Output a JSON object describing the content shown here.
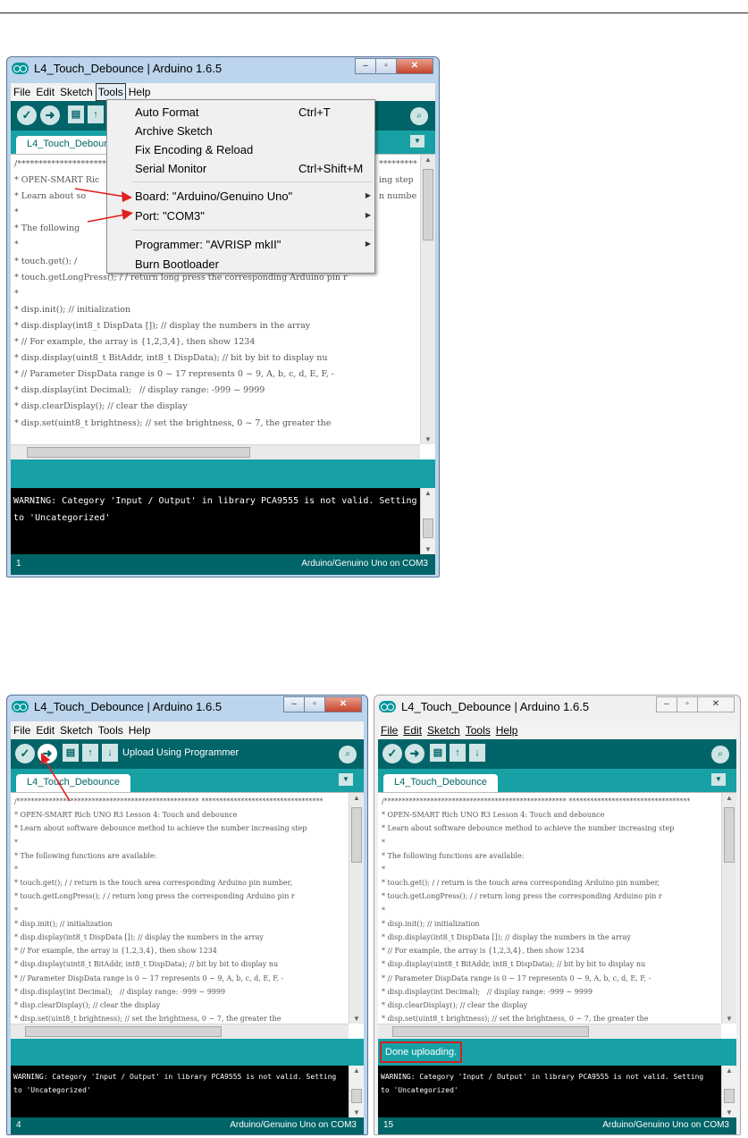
{
  "title": "L4_Touch_Debounce | Arduino 1.6.5",
  "tab_label": "L4_Touch_Debounce",
  "menus": [
    "File",
    "Edit",
    "Sketch",
    "Tools",
    "Help"
  ],
  "tools_menu": {
    "items": [
      {
        "label": "Auto Format",
        "shortcut": "Ctrl+T"
      },
      {
        "label": "Archive Sketch",
        "shortcut": ""
      },
      {
        "label": "Fix Encoding & Reload",
        "shortcut": ""
      },
      {
        "label": "Serial Monitor",
        "shortcut": "Ctrl+Shift+M"
      },
      {
        "label": "Board: \"Arduino/Genuino Uno\"",
        "shortcut": ""
      },
      {
        "label": "Port: \"COM3\"",
        "shortcut": ""
      },
      {
        "label": "Programmer: \"AVRISP mkII\"",
        "shortcut": ""
      },
      {
        "label": "Burn Bootloader",
        "shortcut": ""
      }
    ]
  },
  "toolbar": {
    "hint": "Upload Using Programmer"
  },
  "code_top": [
    "/*************************************************** ************************",
    "* OPEN-SMART Ric",
    "* Learn about so",
    "*",
    "* The following",
    "*",
    "* touch.get(); /",
    "* touch.getLongPress(); / / return long press the corresponding Arduino pin r",
    "*",
    "* disp.init(); // initialization",
    "* disp.display(int8_t DispData []); // display the numbers in the array",
    "* // For example, the array is {1,2,3,4}, then show 1234",
    "* disp.display(uint8_t BitAddr, int8_t DispData); // bit by bit to display nu",
    "* // Parameter DispData range is 0 ~ 17 represents 0 ~ 9, A, b, c, d, E, F, -",
    "* disp.display(int Decimal);   // display range: -999 ~ 9999",
    "* disp.clearDisplay(); // clear the display",
    "* disp.set(uint8_t brightness); // set the brightness, 0 ~ 7, the greater the"
  ],
  "code_top_right": [
    "*****************",
    "",
    "ing step",
    "",
    "",
    "",
    "n number,"
  ],
  "code_full": [
    "/*************************************************** **********************************",
    "* OPEN-SMART Rich UNO R3 Lesson 4: Touch and debounce",
    "* Learn about software debounce method to achieve the number increasing step",
    "*",
    "* The following functions are available:",
    "*",
    "* touch.get(); / / return is the touch area corresponding Arduino pin number,",
    "* touch.getLongPress(); / / return long press the corresponding Arduino pin r",
    "*",
    "* disp.init(); // initialization",
    "* disp.display(int8_t DispData []); // display the numbers in the array",
    "* // For example, the array is {1,2,3,4}, then show 1234",
    "* disp.display(uint8_t BitAddr, int8_t DispData); // bit by bit to display nu",
    "* // Parameter DispData range is 0 ~ 17 represents 0 ~ 9, A, b, c, d, E, F, -",
    "* disp.display(int Decimal);   // display range: -999 ~ 9999",
    "* disp.clearDisplay(); // clear the display",
    "* disp.set(uint8_t brightness); // set the brightness, 0 ~ 7, the greater the"
  ],
  "console_text": "WARNING: Category 'Input / Output' in library PCA9555 is not valid. Setting\nto 'Uncategorized'",
  "status_done": "Done uploading.",
  "board_status": "Arduino/Genuino Uno on COM3",
  "line_numbers": {
    "top": "1",
    "bottom_left": "4",
    "bottom_right": "15"
  },
  "colors": {
    "teal_dark": "#006468",
    "teal": "#17a1a5",
    "console": "#000000",
    "highlight_red": "#d02020"
  },
  "icons": [
    "arduino-logo-icon",
    "verify-icon",
    "upload-icon",
    "new-icon",
    "open-icon",
    "save-icon",
    "serial-monitor-icon"
  ]
}
